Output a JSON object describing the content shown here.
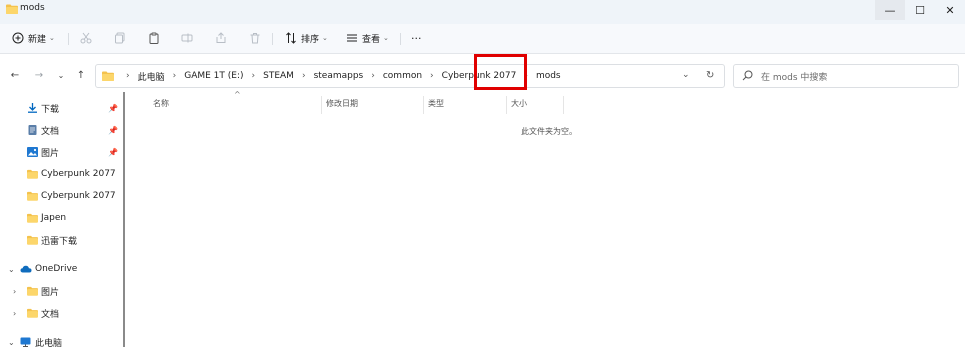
{
  "window": {
    "title": "mods",
    "controls": {
      "minimize": "—",
      "maximize": "☐",
      "close": "✕"
    }
  },
  "toolbar": {
    "new_label": "新建",
    "sort_label": "排序",
    "view_label": "查看",
    "more_label": "···"
  },
  "nav": {
    "back": "←",
    "forward": "→",
    "recent": "⌄",
    "up": "↑"
  },
  "address": {
    "crumbs": [
      "此电脑",
      "GAME 1T (E:)",
      "STEAM",
      "steamapps",
      "common",
      "Cyberpunk 2077",
      "mods"
    ],
    "separator": "›",
    "dropdown": "⌄",
    "refresh": "↻"
  },
  "search": {
    "placeholder": "在 mods 中搜索"
  },
  "sidebar": {
    "items": [
      {
        "label": "下载",
        "icon": "download-icon",
        "pinned": true
      },
      {
        "label": "文档",
        "icon": "document-icon",
        "pinned": true
      },
      {
        "label": "图片",
        "icon": "picture-icon",
        "pinned": true
      },
      {
        "label": "Cyberpunk 2077",
        "icon": "folder-icon"
      },
      {
        "label": "Cyberpunk 2077",
        "icon": "folder-icon"
      },
      {
        "label": "Japen",
        "icon": "folder-icon"
      },
      {
        "label": "迅雷下载",
        "icon": "folder-icon"
      },
      {
        "label": "OneDrive",
        "icon": "cloud-icon",
        "chevron": "⌄"
      },
      {
        "label": "图片",
        "icon": "folder-icon",
        "chevron": "›"
      },
      {
        "label": "文档",
        "icon": "folder-icon",
        "chevron": "›"
      },
      {
        "label": "此电脑",
        "icon": "pc-icon",
        "chevron": "⌄"
      }
    ]
  },
  "content": {
    "columns": [
      "名称",
      "修改日期",
      "类型",
      "大小"
    ],
    "sort_indicator": "^",
    "empty_message": "此文件夹为空。"
  },
  "colors": {
    "folder": "#f4c24d",
    "accent": "#0067c0",
    "highlight": "#e00000"
  }
}
